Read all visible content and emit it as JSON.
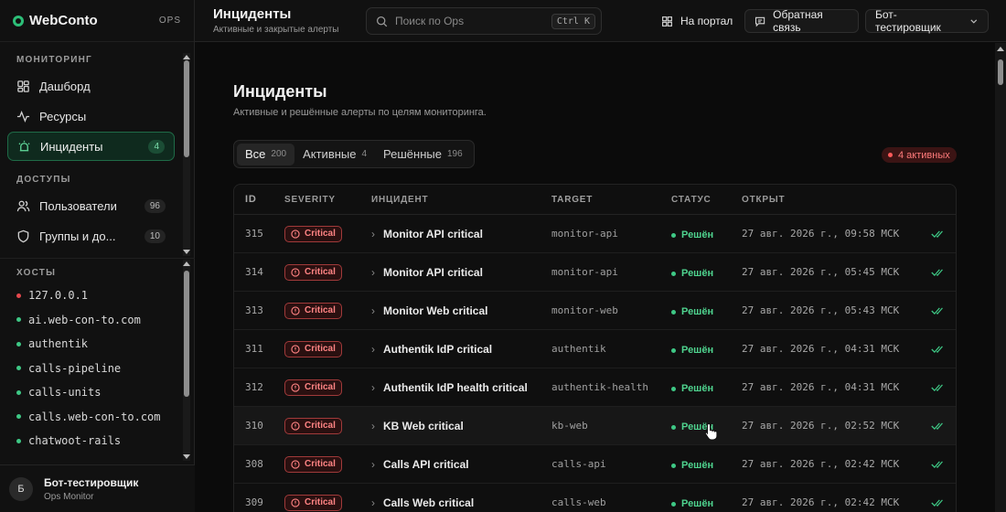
{
  "brand": {
    "name": "WebConto",
    "tag": "OPS"
  },
  "sidebar": {
    "monitoring_title": "МОНИТОРИНГ",
    "monitoring_items": [
      {
        "label": "Дашборд",
        "icon": "dashboard-icon"
      },
      {
        "label": "Ресурсы",
        "icon": "activity-icon"
      },
      {
        "label": "Инциденты",
        "icon": "siren-icon",
        "count": "4",
        "active": true
      }
    ],
    "access_title": "ДОСТУПЫ",
    "access_items": [
      {
        "label": "Пользователи",
        "icon": "users-icon",
        "count": "96"
      },
      {
        "label": "Группы и до...",
        "icon": "shield-icon",
        "count": "10"
      }
    ],
    "hosts_title": "ХОСТЫ",
    "hosts": [
      {
        "name": "127.0.0.1",
        "status_color": "#e5484d"
      },
      {
        "name": "ai.web-con-to.com",
        "status_color": "#3ec885"
      },
      {
        "name": "authentik",
        "status_color": "#3ec885"
      },
      {
        "name": "calls-pipeline",
        "status_color": "#3ec885"
      },
      {
        "name": "calls-units",
        "status_color": "#3ec885"
      },
      {
        "name": "calls.web-con-to.com",
        "status_color": "#3ec885"
      },
      {
        "name": "chatwoot-rails",
        "status_color": "#3ec885"
      }
    ],
    "user": {
      "avatar": "Б",
      "name": "Бот-тестировщик",
      "sub": "Ops Monitor"
    }
  },
  "topbar": {
    "title": "Инциденты",
    "subtitle": "Активные и закрытые алерты",
    "search_placeholder": "Поиск по Ops",
    "search_shortcut": "Ctrl K",
    "portal_label": "На портал",
    "feedback_label": "Обратная связь",
    "user_menu_label": "Бот-тестировщик"
  },
  "main": {
    "title": "Инциденты",
    "subtitle": "Активные и решённые алерты по целям мониторинга.",
    "tabs": [
      {
        "label": "Все",
        "count": "200",
        "active": true
      },
      {
        "label": "Активные",
        "count": "4"
      },
      {
        "label": "Решённые",
        "count": "196"
      }
    ],
    "active_badge": "4 активных",
    "columns": [
      "ID",
      "SEVERITY",
      "ИНЦИДЕНТ",
      "TARGET",
      "СТАТУС",
      "ОТКРЫТ"
    ],
    "rows": [
      {
        "id": "315",
        "severity": "Critical",
        "incident": "Monitor API critical",
        "target": "monitor-api",
        "status": "Решён",
        "opened": "27 авг. 2026 г., 09:58 МСК"
      },
      {
        "id": "314",
        "severity": "Critical",
        "incident": "Monitor API critical",
        "target": "monitor-api",
        "status": "Решён",
        "opened": "27 авг. 2026 г., 05:45 МСК"
      },
      {
        "id": "313",
        "severity": "Critical",
        "incident": "Monitor Web critical",
        "target": "monitor-web",
        "status": "Решён",
        "opened": "27 авг. 2026 г., 05:43 МСК"
      },
      {
        "id": "311",
        "severity": "Critical",
        "incident": "Authentik IdP critical",
        "target": "authentik",
        "status": "Решён",
        "opened": "27 авг. 2026 г., 04:31 МСК"
      },
      {
        "id": "312",
        "severity": "Critical",
        "incident": "Authentik IdP health critical",
        "target": "authentik-health",
        "status": "Решён",
        "opened": "27 авг. 2026 г., 04:31 МСК"
      },
      {
        "id": "310",
        "severity": "Critical",
        "incident": "KB Web critical",
        "target": "kb-web",
        "status": "Решён",
        "opened": "27 авг. 2026 г., 02:52 МСК",
        "hover": true
      },
      {
        "id": "308",
        "severity": "Critical",
        "incident": "Calls API critical",
        "target": "calls-api",
        "status": "Решён",
        "opened": "27 авг. 2026 г., 02:42 МСК"
      },
      {
        "id": "309",
        "severity": "Critical",
        "incident": "Calls Web critical",
        "target": "calls-web",
        "status": "Решён",
        "opened": "27 авг. 2026 г., 02:42 МСК"
      }
    ]
  },
  "colors": {
    "accent": "#2dbf78",
    "critical": "#ff8383",
    "resolved": "#4fd48f"
  }
}
